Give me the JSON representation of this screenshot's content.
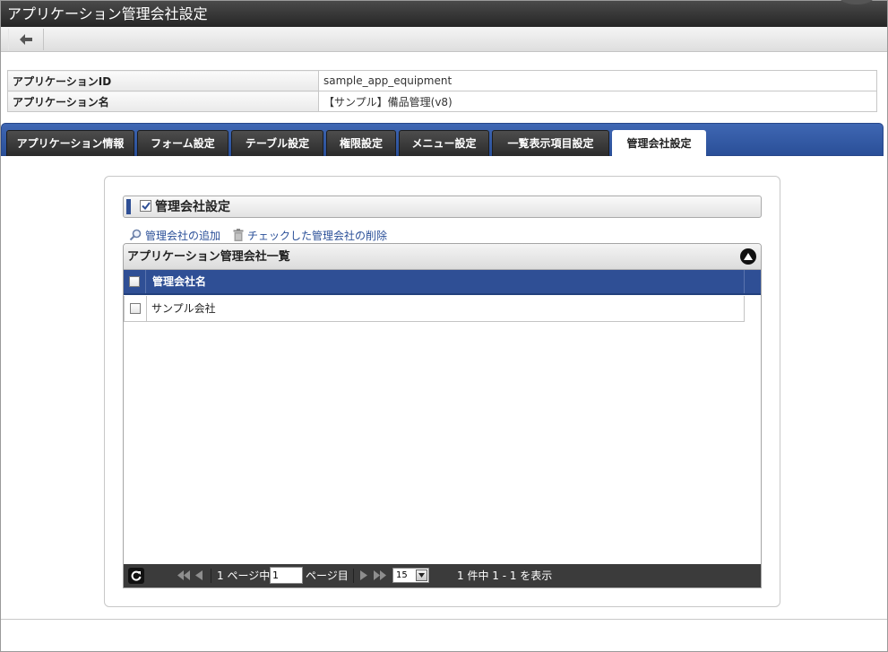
{
  "window": {
    "title": "アプリケーション管理会社設定"
  },
  "toolbar": {
    "back_icon": "arrow-left-icon"
  },
  "app_info": {
    "rows": [
      {
        "label": "アプリケーションID",
        "value": "sample_app_equipment"
      },
      {
        "label": "アプリケーション名",
        "value": "【サンプル】備品管理(v8)"
      }
    ]
  },
  "tabs": [
    {
      "label": "アプリケーション情報",
      "active": false
    },
    {
      "label": "フォーム設定",
      "active": false
    },
    {
      "label": "テーブル設定",
      "active": false
    },
    {
      "label": "権限設定",
      "active": false
    },
    {
      "label": "メニュー設定",
      "active": false
    },
    {
      "label": "一覧表示項目設定",
      "active": false
    },
    {
      "label": "管理会社設定",
      "active": true
    }
  ],
  "section": {
    "title": "管理会社設定",
    "checked": true
  },
  "actions": {
    "add_label": "管理会社の追加",
    "delete_label": "チェックした管理会社の削除"
  },
  "grid": {
    "caption": "アプリケーション管理会社一覧",
    "columns": [
      "管理会社名"
    ],
    "rows": [
      {
        "name": "サンプル会社",
        "checked": false
      }
    ],
    "pager": {
      "page_prefix": "1 ページ中",
      "current_page": "1",
      "page_suffix": "ページ目",
      "rows_per_page": "15",
      "summary": "1 件中 1 - 1 を表示"
    }
  },
  "colors": {
    "tab_bar": "#2f4f95",
    "grid_header": "#2f4f95",
    "title_bar": "#2f2f2f",
    "link": "#2a4f98"
  }
}
